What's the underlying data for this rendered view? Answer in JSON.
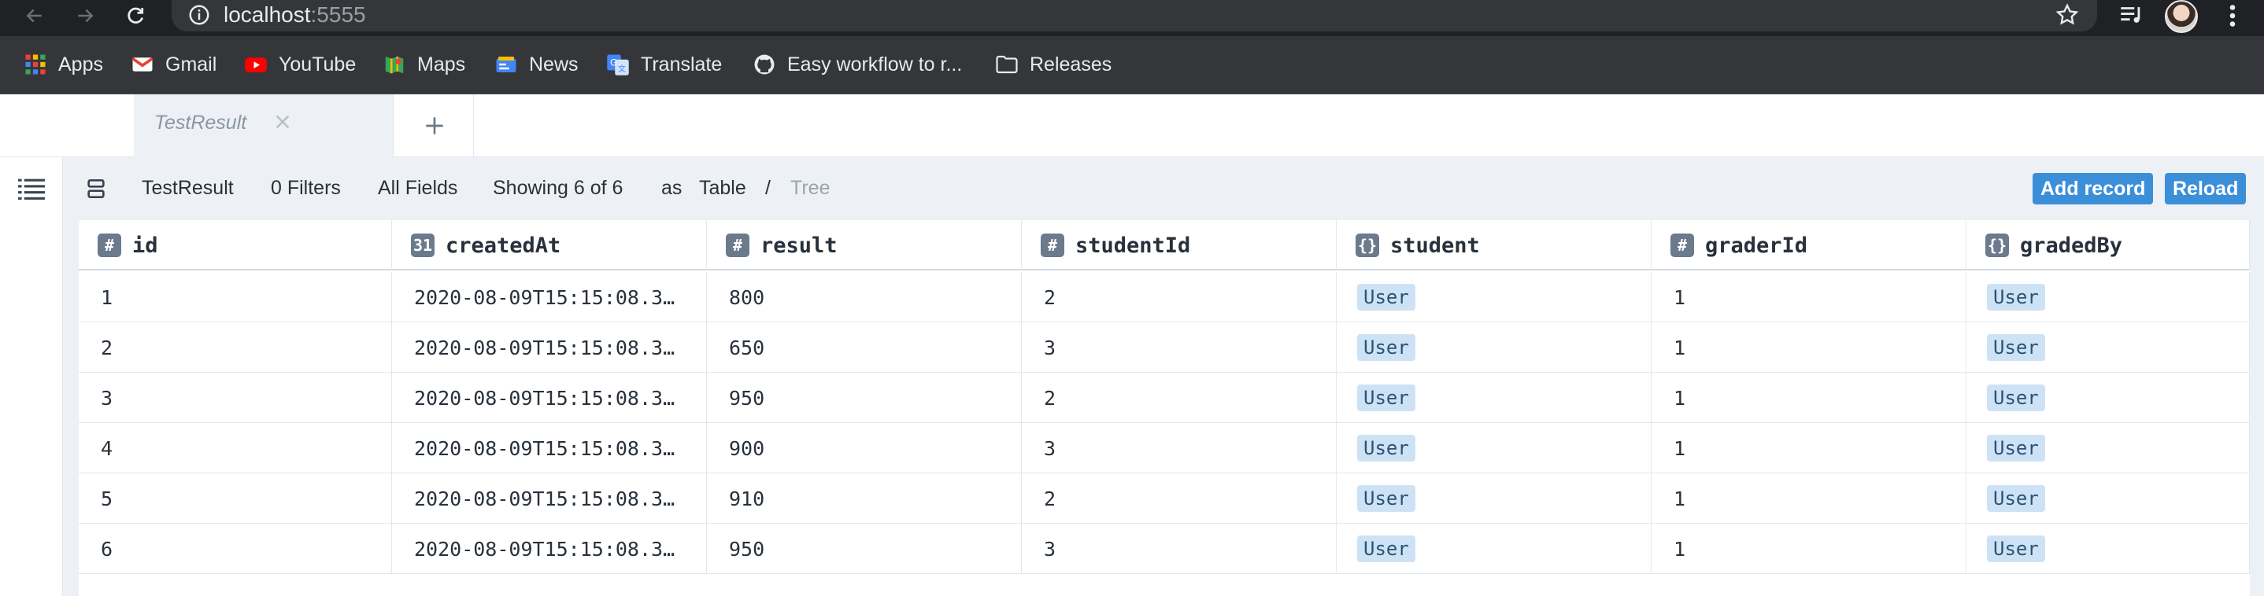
{
  "browser": {
    "url_host": "localhost",
    "url_port": ":5555",
    "bookmarks": [
      {
        "label": "Apps",
        "icon": "apps-grid-icon"
      },
      {
        "label": "Gmail",
        "icon": "gmail-icon"
      },
      {
        "label": "YouTube",
        "icon": "youtube-icon"
      },
      {
        "label": "Maps",
        "icon": "maps-icon"
      },
      {
        "label": "News",
        "icon": "news-icon"
      },
      {
        "label": "Translate",
        "icon": "translate-icon"
      },
      {
        "label": "Easy workflow to r...",
        "icon": "github-icon"
      },
      {
        "label": "Releases",
        "icon": "folder-icon"
      }
    ]
  },
  "tabs": {
    "active_label": "TestResult"
  },
  "toolbar": {
    "model": "TestResult",
    "filters": "0 Filters",
    "fields": "All Fields",
    "showing": "Showing 6 of 6",
    "as": "as",
    "view_table": "Table",
    "separator": "/",
    "view_tree": "Tree",
    "add_record": "Add record",
    "reload": "Reload"
  },
  "colors": {
    "accent": "#3b8fd9",
    "badge_bg": "#cde3f5",
    "chrome_dark": "#202124",
    "canvas": "#edf1f5"
  },
  "table": {
    "columns": [
      {
        "name": "id",
        "type_icon": "#"
      },
      {
        "name": "createdAt",
        "type_icon": "31"
      },
      {
        "name": "result",
        "type_icon": "#"
      },
      {
        "name": "studentId",
        "type_icon": "#"
      },
      {
        "name": "student",
        "type_icon": "{}"
      },
      {
        "name": "graderId",
        "type_icon": "#"
      },
      {
        "name": "gradedBy",
        "type_icon": "{}"
      }
    ],
    "rows": [
      {
        "id": "1",
        "createdAt": "2020-08-09T15:15:08.3…",
        "result": "800",
        "studentId": "2",
        "student": "User",
        "graderId": "1",
        "gradedBy": "User"
      },
      {
        "id": "2",
        "createdAt": "2020-08-09T15:15:08.3…",
        "result": "650",
        "studentId": "3",
        "student": "User",
        "graderId": "1",
        "gradedBy": "User"
      },
      {
        "id": "3",
        "createdAt": "2020-08-09T15:15:08.3…",
        "result": "950",
        "studentId": "2",
        "student": "User",
        "graderId": "1",
        "gradedBy": "User"
      },
      {
        "id": "4",
        "createdAt": "2020-08-09T15:15:08.3…",
        "result": "900",
        "studentId": "3",
        "student": "User",
        "graderId": "1",
        "gradedBy": "User"
      },
      {
        "id": "5",
        "createdAt": "2020-08-09T15:15:08.3…",
        "result": "910",
        "studentId": "2",
        "student": "User",
        "graderId": "1",
        "gradedBy": "User"
      },
      {
        "id": "6",
        "createdAt": "2020-08-09T15:15:08.3…",
        "result": "950",
        "studentId": "3",
        "student": "User",
        "graderId": "1",
        "gradedBy": "User"
      }
    ]
  }
}
